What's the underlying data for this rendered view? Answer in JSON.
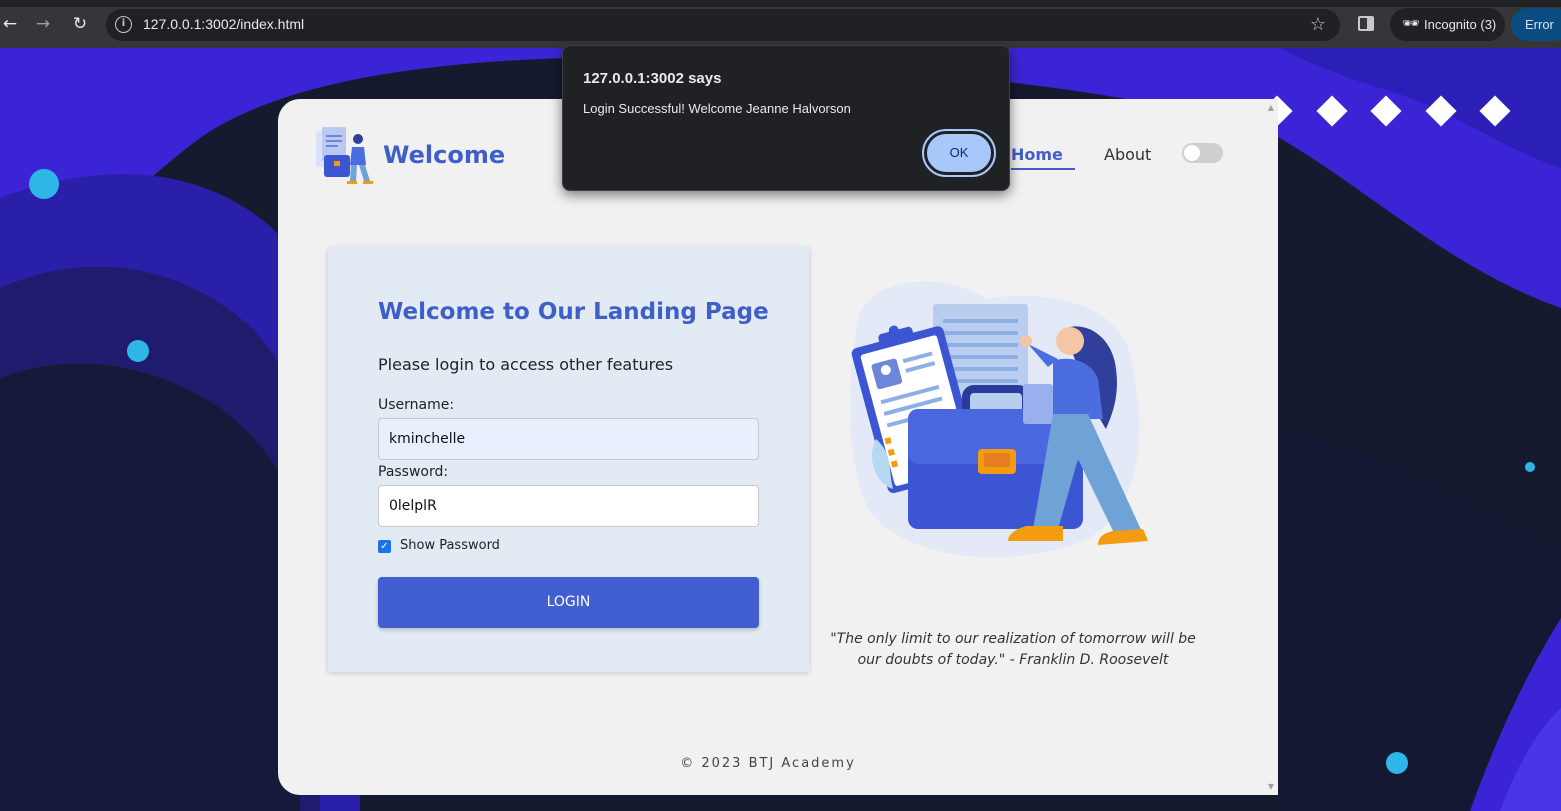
{
  "browser": {
    "url": "127.0.0.1:3002/index.html",
    "incognito_label": "Incognito (3)",
    "error_label": "Error",
    "icons": {
      "back": "arrow-left-icon",
      "forward": "arrow-right-icon",
      "reload": "reload-icon",
      "site_info": "info-icon",
      "bookmark": "star-icon",
      "side_panel": "side-panel-icon",
      "incognito": "incognito-icon"
    }
  },
  "header": {
    "brand": "Welcome",
    "nav": {
      "home": "Home",
      "about": "About"
    },
    "theme_toggle": false
  },
  "login": {
    "title": "Welcome to Our Landing Page",
    "subtitle": "Please login to access other features",
    "username_label": "Username:",
    "username_value": "kminchelle",
    "password_label": "Password:",
    "password_value": "0lelplR",
    "show_password_label": "Show Password",
    "show_password_checked": true,
    "button_label": "LOGIN"
  },
  "quote": "\"The only limit to our realization of tomorrow will be our doubts of today.\" - Franklin D. Roosevelt",
  "footer": "© 2023 BTJ Academy",
  "alert": {
    "title": "127.0.0.1:3002 says",
    "message": "Login Successful! Welcome Jeanne Halvorson",
    "ok_label": "OK"
  },
  "colors": {
    "accent": "#3f5ec9",
    "button": "#415fd0",
    "background_dark": "#151a2e",
    "background_purple": "#3b24d6",
    "dot": "#2fb6e8"
  }
}
